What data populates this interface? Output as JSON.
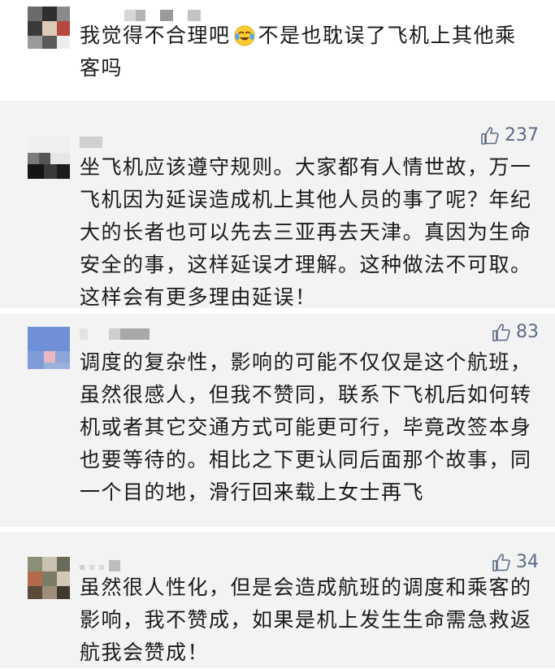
{
  "comments": [
    {
      "text_before": "我觉得不合理吧",
      "emoji": "crying-laughing-emoji",
      "text_after": "不是也耽误了飞机上其他乘客吗",
      "likes": ""
    },
    {
      "text": "坐飞机应该遵守规则。大家都有人情世故，万一飞机因为延误造成机上其他人员的事了呢？年纪大的长者也可以先去三亚再去天津。真因为生命安全的事，这样延误才理解。这种做法不可取。这样会有更多理由延误！",
      "likes": "237"
    },
    {
      "text": "调度的复杂性，影响的可能不仅仅是这个航班，虽然很感人，但我不赞同，联系下飞机后如何转机或者其它交通方式可能更可行，毕竟改签本身也要等待的。相比之下更认同后面那个故事，同一个目的地，滑行回来载上女士再飞",
      "likes": "83"
    },
    {
      "text": "虽然很人性化，但是会造成航班的调度和乘客的影响，我不赞成，如果是机上发生生命需急救返航我会赞成！",
      "likes": "34"
    }
  ],
  "colors": {
    "card_bg": "#f3f3f3",
    "like_color": "#5b6b86",
    "text_color": "#1b1b1b"
  }
}
